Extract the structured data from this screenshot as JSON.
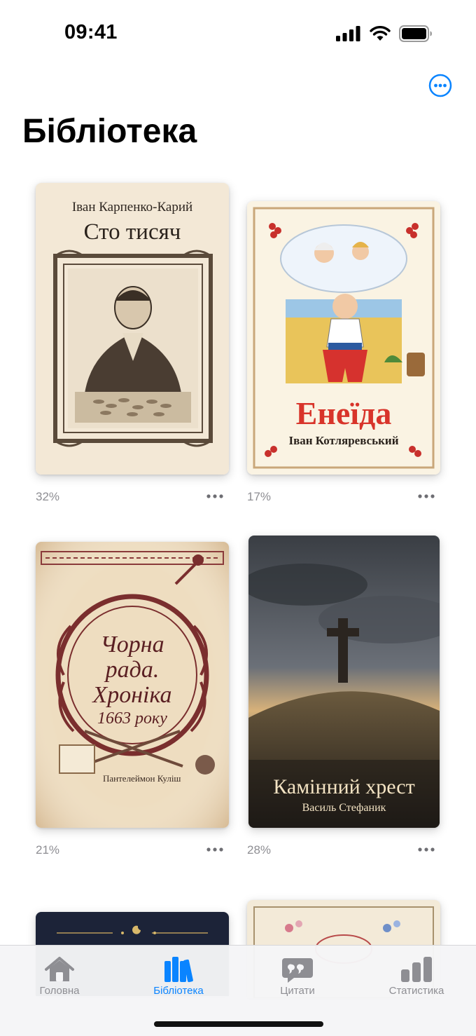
{
  "status": {
    "time": "09:41"
  },
  "header": {
    "title": "Бібліотека"
  },
  "books": [
    {
      "author": "Іван Карпенко-Карий",
      "title": "Сто тисяч",
      "progress": "32%"
    },
    {
      "title": "Енеїда",
      "author": "Іван Котляревський",
      "progress": "17%"
    },
    {
      "title_lines": [
        "Чорна",
        "рада.",
        "Хроніка",
        "1663 року"
      ],
      "author": "Пантелеймон Куліш",
      "progress": "21%"
    },
    {
      "title": "Камінний хрест",
      "author": "Василь Стефаник",
      "progress": "28%"
    }
  ],
  "tabs": [
    {
      "label": "Головна",
      "icon": "house-icon"
    },
    {
      "label": "Бібліотека",
      "icon": "books-icon",
      "active": true
    },
    {
      "label": "Цитати",
      "icon": "quote-bubble-icon"
    },
    {
      "label": "Статистика",
      "icon": "bar-chart-icon"
    }
  ],
  "colors": {
    "accent": "#0a84ff",
    "inactive": "#8e8e93"
  }
}
